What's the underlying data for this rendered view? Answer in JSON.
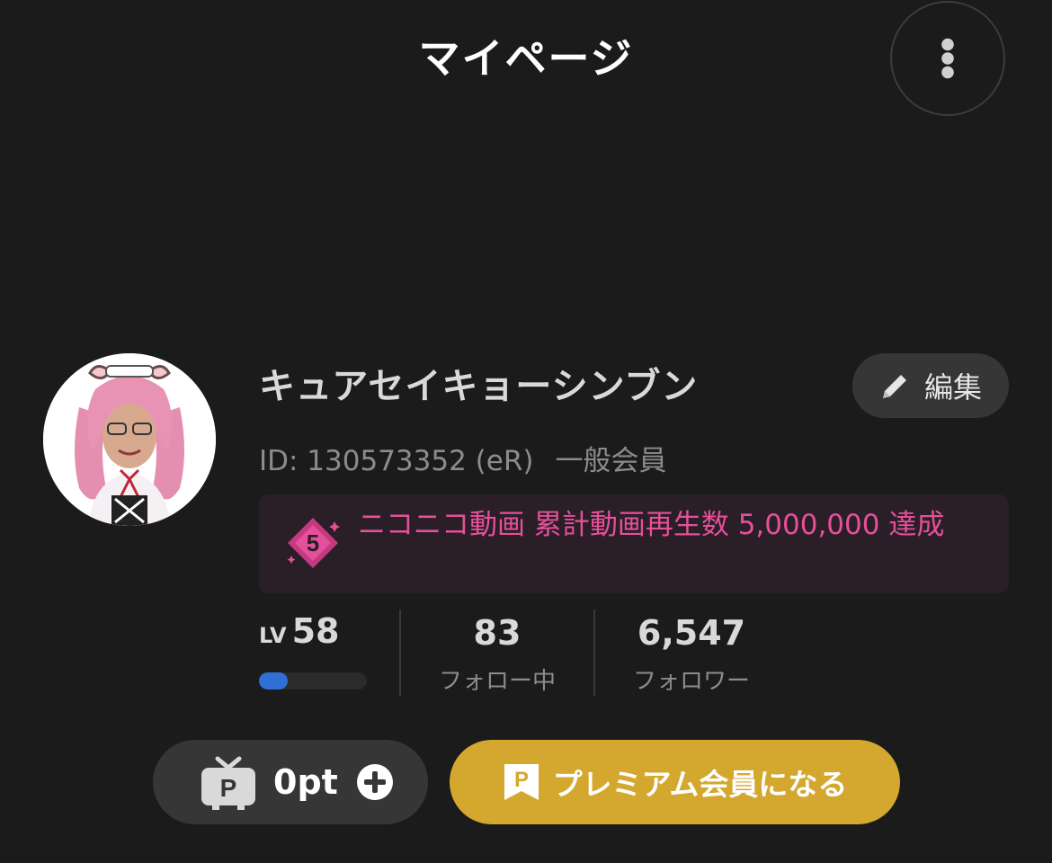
{
  "header": {
    "title": "マイページ",
    "menu_icon": "more-vertical-icon"
  },
  "profile": {
    "name": "キュアセイキョーシンブン",
    "edit_label": "編集",
    "edit_icon": "pencil-icon",
    "id_text": "ID: 130573352 (eR)",
    "member_type": "一般会員",
    "avatar_icon": "user-avatar"
  },
  "achievement": {
    "text": "ニコニコ動画 累計動画再生数 5,000,000 達成",
    "icon": "achievement-badge-icon",
    "color": "#e5509a"
  },
  "stats": {
    "level_prefix": "LV",
    "level_value": "58",
    "level_progress": 0.27,
    "following_count": "83",
    "following_label": "フォロー中",
    "followers_count": "6,547",
    "followers_label": "フォロワー"
  },
  "points": {
    "value": "0pt",
    "tv_icon": "niconico-point-tv-icon",
    "add_icon": "plus-circle-icon"
  },
  "premium": {
    "label": "プレミアム会員になる",
    "icon": "premium-p-icon",
    "color": "#d4a82f"
  }
}
